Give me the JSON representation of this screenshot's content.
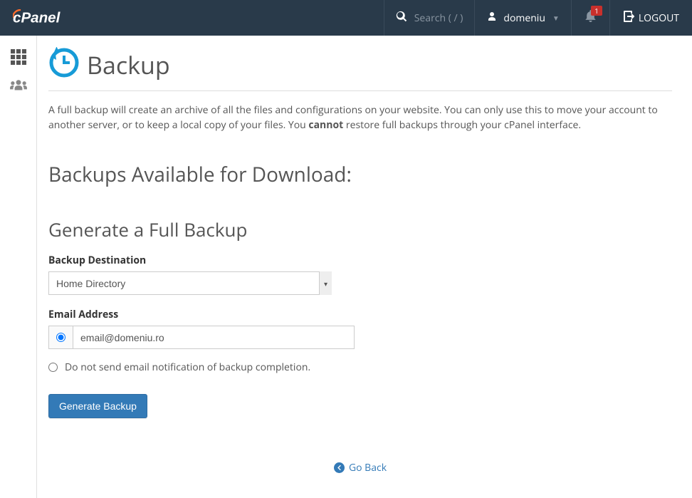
{
  "topbar": {
    "search_placeholder": "Search ( / )",
    "username": "domeniu",
    "notification_count": "1",
    "logout_label": "LOGOUT"
  },
  "page": {
    "title": "Backup",
    "description_part1": "A full backup will create an archive of all the files and configurations on your website. You can only use this to move your account to another server, or to keep a local copy of your files. You ",
    "description_bold": "cannot",
    "description_part2": " restore full backups through your cPanel interface."
  },
  "backups_heading": "Backups Available for Download:",
  "form": {
    "section_title": "Generate a Full Backup",
    "destination_label": "Backup Destination",
    "destination_value": "Home Directory",
    "email_label": "Email Address",
    "email_value": "email@domeniu.ro",
    "no_notify_label": "Do not send email notification of backup completion.",
    "submit_label": "Generate Backup"
  },
  "nav": {
    "go_back": "Go Back"
  }
}
